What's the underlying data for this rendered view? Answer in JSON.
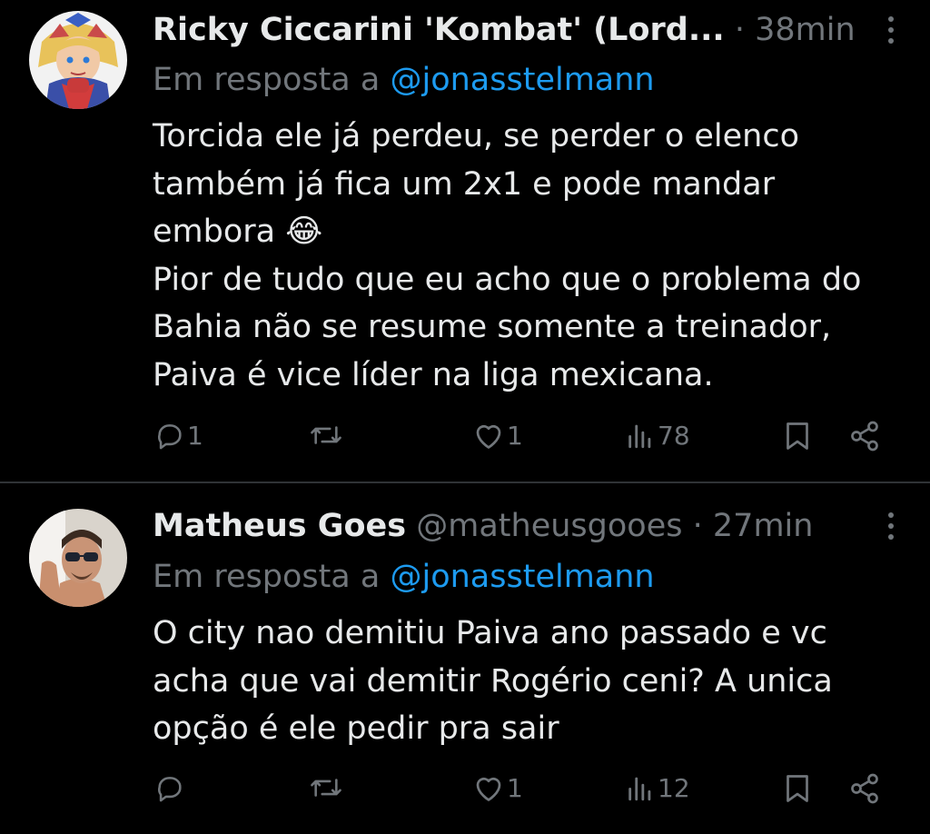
{
  "tweets": [
    {
      "author_name": "Ricky Ciccarini 'Kombat' (Lord...",
      "handle": "",
      "separator": "·",
      "time": "38min",
      "reply_prefix": "Em resposta a",
      "reply_to": "@jonasstelmann",
      "body_lines": [
        "Torcida ele já perdeu, se perder o elenco",
        "também já fica um 2x1 e pode mandar",
        "embora 😂",
        "Pior de tudo que eu acho que  o  problema do",
        "Bahia não se resume somente a treinador,",
        "Paiva é vice líder na liga mexicana."
      ],
      "replies": "1",
      "reposts": "",
      "likes": "1",
      "views": "78"
    },
    {
      "author_name": "Matheus Goes",
      "handle": "@matheusgooes",
      "separator": "·",
      "time": "27min",
      "reply_prefix": "Em resposta a",
      "reply_to": "@jonasstelmann",
      "body_lines": [
        "O city nao demitiu Paiva ano passado e vc",
        "acha que vai demitir Rogério ceni? A unica",
        "opção é ele pedir pra sair"
      ],
      "replies": "",
      "reposts": "",
      "likes": "1",
      "views": "12"
    }
  ],
  "icons": {
    "reply": "reply-icon",
    "repost": "repost-icon",
    "like": "heart-icon",
    "views": "views-icon",
    "bookmark": "bookmark-icon",
    "share": "share-icon",
    "more": "more-icon"
  },
  "colors": {
    "background": "#000000",
    "text": "#e7e9ea",
    "muted": "#71767b",
    "link": "#1d9bf0",
    "divider": "#2f3336"
  }
}
